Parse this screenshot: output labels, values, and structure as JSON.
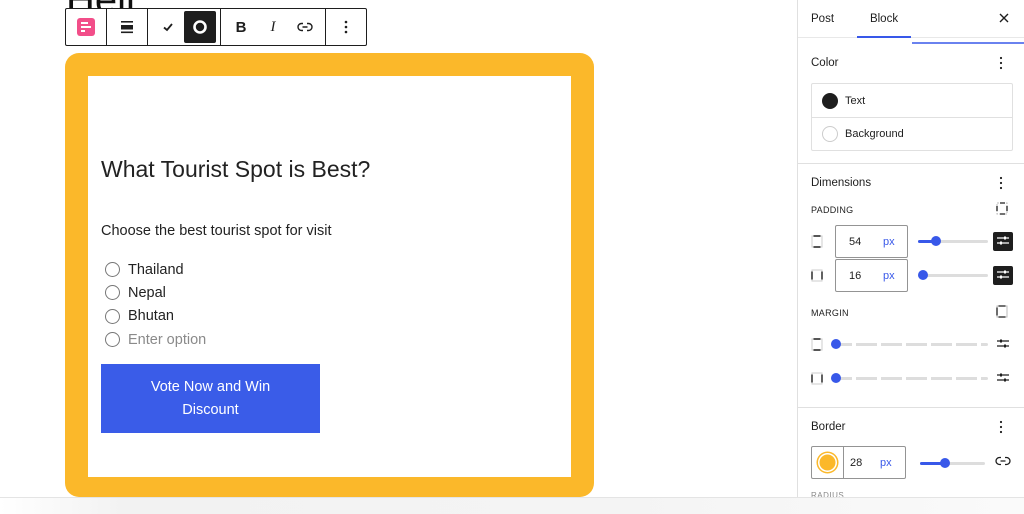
{
  "canvas": {
    "post_title_fragment": "Hell",
    "toolbar": {
      "buttons": [
        {
          "name": "block-type",
          "icon": "poll-block-icon"
        },
        {
          "name": "align",
          "icon": "align-icon"
        },
        {
          "name": "check",
          "icon": "check-icon"
        },
        {
          "name": "circle-style",
          "icon": "circle-icon"
        },
        {
          "name": "bold",
          "label": "B"
        },
        {
          "name": "italic",
          "label": "I"
        },
        {
          "name": "link",
          "icon": "link-icon"
        },
        {
          "name": "more-options",
          "icon": "more-vertical-icon"
        }
      ],
      "bold_label": "B",
      "italic_label": "I"
    },
    "poll": {
      "title": "What Tourist Spot is Best?",
      "description": "Choose the best tourist spot for visit",
      "options": [
        "Thailand",
        "Nepal",
        "Bhutan"
      ],
      "new_option_placeholder": "Enter option",
      "vote_button_label": "Vote Now and Win Discount",
      "border_color": "#fbb82a",
      "button_color": "#3a5ce8"
    }
  },
  "sidebar": {
    "tabs": [
      {
        "label": "Post",
        "active": false
      },
      {
        "label": "Block",
        "active": true
      }
    ],
    "close_label": "Close",
    "color_panel": {
      "title": "Color",
      "items": [
        {
          "label": "Text",
          "swatch": "#1e1e1e"
        },
        {
          "label": "Background",
          "swatch": "none"
        }
      ]
    },
    "dimensions_panel": {
      "title": "Dimensions",
      "padding_label": "PADDING",
      "padding": [
        {
          "side": "vertical",
          "value": "54",
          "unit": "px",
          "slider_fraction": 0.18
        },
        {
          "side": "horizontal",
          "value": "16",
          "unit": "px",
          "slider_fraction": 0.0
        }
      ],
      "margin_label": "MARGIN",
      "margin": [
        {
          "side": "vertical",
          "slider_fraction": 0.0
        },
        {
          "side": "horizontal",
          "slider_fraction": 0.0
        }
      ]
    },
    "border_panel": {
      "title": "Border",
      "color": "#fbb82a",
      "width_value": "28",
      "width_unit": "px",
      "slider_fraction": 0.3,
      "next_section_label": "RADIUS"
    },
    "accent_color": "#3858e9"
  }
}
